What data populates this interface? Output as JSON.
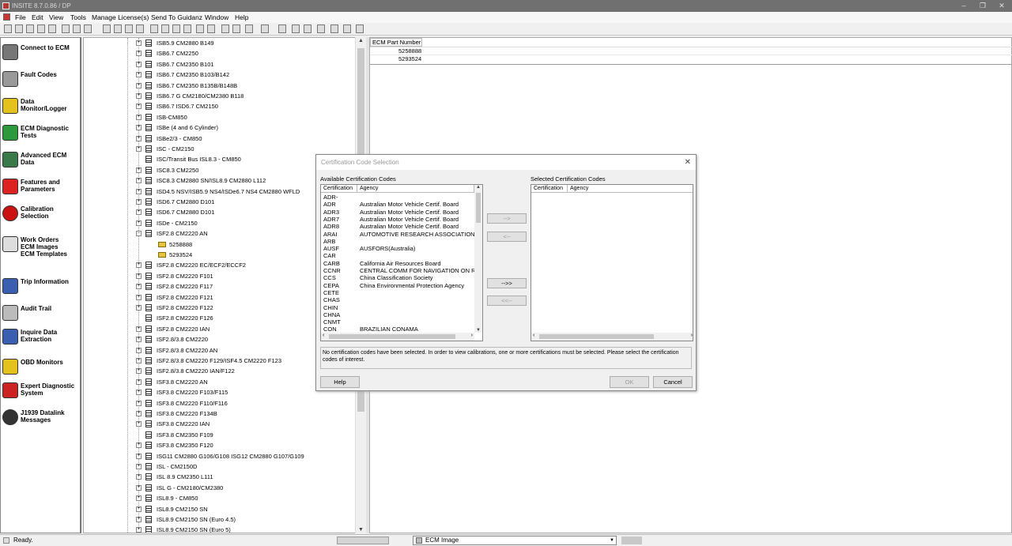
{
  "window": {
    "title": "INSITE 8.7.0.86 / DP"
  },
  "menu": [
    "File",
    "Edit",
    "View",
    "Tools",
    "Manage License(s)",
    "Send To Guidanz",
    "Window",
    "Help"
  ],
  "sidebar": [
    {
      "label": "Connect to ECM",
      "icon": "connect-ecm-icon"
    },
    {
      "label": "Fault Codes",
      "icon": "fault-codes-icon"
    },
    {
      "label": "Data\nMonitor/Logger",
      "icon": "data-monitor-icon"
    },
    {
      "label": "ECM Diagnostic\nTests",
      "icon": "diagnostic-tests-icon"
    },
    {
      "label": "Advanced ECM\nData",
      "icon": "advanced-data-icon"
    },
    {
      "label": "Features and\nParameters",
      "icon": "features-icon"
    },
    {
      "label": "Calibration\nSelection",
      "icon": "calibration-icon"
    },
    {
      "label": "Work Orders\nECM Images\nECM Templates",
      "icon": "work-orders-icon"
    },
    {
      "label": "Trip Information",
      "icon": "trip-info-icon"
    },
    {
      "label": "Audit Trail",
      "icon": "audit-trail-icon"
    },
    {
      "label": "Inquire Data\nExtraction",
      "icon": "inquire-icon"
    },
    {
      "label": "OBD Monitors",
      "icon": "obd-icon"
    },
    {
      "label": "Expert Diagnostic\nSystem",
      "icon": "expert-icon"
    },
    {
      "label": "J1939 Datalink\nMessages",
      "icon": "j1939-icon"
    }
  ],
  "tree": [
    {
      "label": "ISB5.9 CM2880 B149",
      "exp": true
    },
    {
      "label": "ISB6.7 CM2250",
      "exp": true
    },
    {
      "label": "ISB6.7 CM2350 B101",
      "exp": true
    },
    {
      "label": "ISB6.7 CM2350 B103/B142",
      "exp": true
    },
    {
      "label": "ISB6.7 CM2350 B135B/B148B",
      "exp": true
    },
    {
      "label": "ISB6.7 G CM2180/CM2380 B118",
      "exp": true
    },
    {
      "label": "ISB6.7 ISD6.7 CM2150",
      "exp": true
    },
    {
      "label": "ISB-CM850",
      "exp": true
    },
    {
      "label": "ISBe (4 and 6 Cylinder)",
      "exp": true
    },
    {
      "label": "ISBe2/3 - CM850",
      "exp": true
    },
    {
      "label": "ISC - CM2150",
      "exp": true
    },
    {
      "label": "ISC/Transit Bus ISL8.3 - CM850",
      "exp": false
    },
    {
      "label": "ISC8.3 CM2250",
      "exp": true
    },
    {
      "label": "ISC8.3 CM2880 SN/ISL8.9 CM2880 L112",
      "exp": true
    },
    {
      "label": "ISD4.5 NSV/ISB5.9 NS4/ISDe6.7 NS4 CM2880 WFLD",
      "exp": true
    },
    {
      "label": "ISD6.7 CM2880 D101",
      "exp": true
    },
    {
      "label": "ISD6.7 CM2880 D101",
      "exp": true
    },
    {
      "label": "ISDe - CM2150",
      "exp": true
    },
    {
      "label": "ISF2.8 CM2220 AN",
      "exp": true,
      "open": true
    },
    {
      "label": "5258888",
      "child": true
    },
    {
      "label": "5293524",
      "child": true
    },
    {
      "label": "ISF2.8 CM2220 EC/ECF2/ECCF2",
      "exp": true
    },
    {
      "label": "ISF2.8 CM2220 F101",
      "exp": true
    },
    {
      "label": "ISF2.8 CM2220 F117",
      "exp": true
    },
    {
      "label": "ISF2.8 CM2220 F121",
      "exp": true
    },
    {
      "label": "ISF2.8 CM2220 F122",
      "exp": true
    },
    {
      "label": "ISF2.8 CM2220 F126",
      "exp": false
    },
    {
      "label": "ISF2.8 CM2220 IAN",
      "exp": true
    },
    {
      "label": "ISF2.8/3.8 CM2220",
      "exp": true
    },
    {
      "label": "ISF2.8/3.8 CM2220 AN",
      "exp": true
    },
    {
      "label": "ISF2.8/3.8 CM2220 F129/ISF4.5 CM2220 F123",
      "exp": true
    },
    {
      "label": "ISF2.8/3.8 CM2220 IAN/F122",
      "exp": true
    },
    {
      "label": "ISF3.8 CM2220 AN",
      "exp": true
    },
    {
      "label": "ISF3.8 CM2220 F103/F115",
      "exp": true
    },
    {
      "label": "ISF3.8 CM2220 F110/F116",
      "exp": true
    },
    {
      "label": "ISF3.8 CM2220 F134B",
      "exp": true
    },
    {
      "label": "ISF3.8 CM2220 IAN",
      "exp": true
    },
    {
      "label": "ISF3.8 CM2350 F109",
      "exp": false
    },
    {
      "label": "ISF3.8 CM2350 F120",
      "exp": true
    },
    {
      "label": "ISG11 CM2880 G106/G108 ISG12 CM2880 G107/G109",
      "exp": true
    },
    {
      "label": "ISL - CM2150D",
      "exp": true
    },
    {
      "label": "ISL 8.9 CM2350 L111",
      "exp": true
    },
    {
      "label": "ISL G - CM2180/CM2380",
      "exp": true
    },
    {
      "label": "ISL8.9 - CM850",
      "exp": true
    },
    {
      "label": "ISL8.9 CM2150 SN",
      "exp": true
    },
    {
      "label": "ISL8.9 CM2150 SN (Euro 4.5)",
      "exp": true
    },
    {
      "label": "ISL8.9 CM2150 SN (Euro 5)",
      "exp": true
    }
  ],
  "ecm_panel": {
    "header": "ECM Part Number",
    "rows": [
      "5258888",
      "5293524"
    ]
  },
  "dialog": {
    "title": "Certification Code Selection",
    "available_label": "Available Certification Codes",
    "selected_label": "Selected Certification Codes",
    "col_cert": "Certification",
    "col_agency": "Agency",
    "available": [
      {
        "code": "ADR-",
        "agency": ""
      },
      {
        "code": "ADR",
        "agency": "Australian Motor Vehicle Certif. Board"
      },
      {
        "code": "ADR3",
        "agency": "Australian Motor Vehicle Certif. Board"
      },
      {
        "code": "ADR7",
        "agency": "Australian Motor Vehicle Certif. Board"
      },
      {
        "code": "ADR8",
        "agency": "Australian Motor Vehicle Certif. Board"
      },
      {
        "code": "ARAI",
        "agency": "AUTOMOTIVE RESEARCH ASSOCIATION OF"
      },
      {
        "code": "ARB",
        "agency": ""
      },
      {
        "code": "AUSF",
        "agency": "AUSFORS(Australia)"
      },
      {
        "code": "CAR",
        "agency": ""
      },
      {
        "code": "CARB",
        "agency": "California Air Resources Board"
      },
      {
        "code": "CCNR",
        "agency": "CENTRAL COMM FOR NAVIGATION ON RH"
      },
      {
        "code": "CCS",
        "agency": "China Classification Society"
      },
      {
        "code": "CEPA",
        "agency": "China Environmental Protection Agency"
      },
      {
        "code": "CETE",
        "agency": ""
      },
      {
        "code": "CHAS",
        "agency": ""
      },
      {
        "code": "CHIN",
        "agency": ""
      },
      {
        "code": "CHNA",
        "agency": ""
      },
      {
        "code": "CNMT",
        "agency": ""
      },
      {
        "code": "CON",
        "agency": "BRAZILIAN CONAMA"
      }
    ],
    "btn_add": "-->",
    "btn_remove": "<--",
    "btn_add_all": "-->>",
    "btn_remove_all": "<<--",
    "message": "No certification codes have been selected.  In order to view calibrations, one or more certifications must be selected.  Please select the certification codes of interest.",
    "help": "Help",
    "ok": "OK",
    "cancel": "Cancel"
  },
  "status": {
    "text": "Ready.",
    "combo": "ECM Image"
  }
}
